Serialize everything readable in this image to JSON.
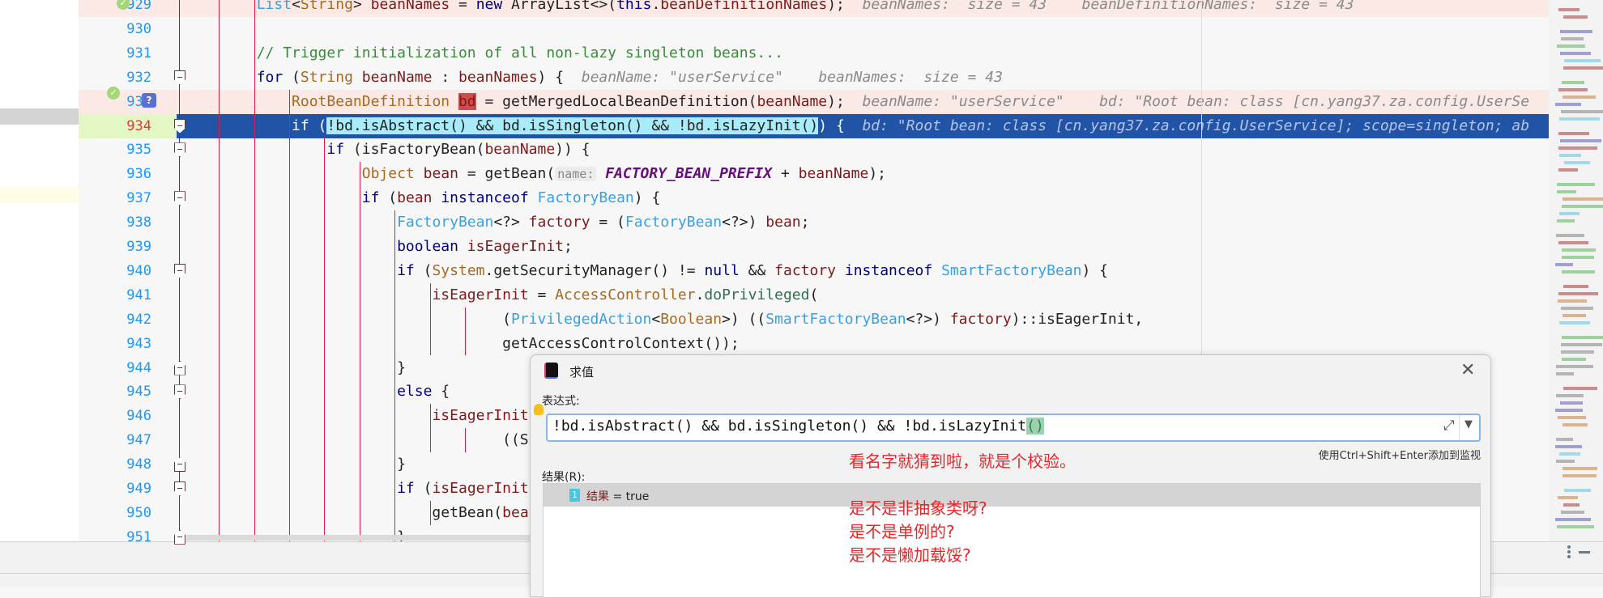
{
  "editor": {
    "lines": [
      {
        "n": "929",
        "bg": "pink",
        "check": true,
        "tokens": [
          [
            "        ",
            ""
          ],
          [
            "List",
            "ty"
          ],
          [
            "<",
            ""
          ],
          [
            "String",
            "cl"
          ],
          [
            "> ",
            ""
          ],
          [
            "beanNames",
            "va"
          ],
          [
            " = ",
            ""
          ],
          [
            "new",
            "kw"
          ],
          [
            " ArrayList<>(",
            ""
          ],
          [
            "this",
            "kw"
          ],
          [
            ".",
            ""
          ],
          [
            "beanDefinitionNames",
            "va"
          ],
          [
            ");",
            ""
          ],
          [
            "  beanNames:  size = 43    beanDefinitionNames:  size = 43",
            "hint"
          ]
        ]
      },
      {
        "n": "930",
        "tokens": []
      },
      {
        "n": "931",
        "tokens": [
          [
            "        ",
            ""
          ],
          [
            "// Trigger initialization of all non-lazy singleton beans...",
            "cm"
          ]
        ]
      },
      {
        "n": "932",
        "tokens": [
          [
            "        ",
            ""
          ],
          [
            "for",
            "kw"
          ],
          [
            " (",
            ""
          ],
          [
            "String",
            "cl"
          ],
          [
            " ",
            ""
          ],
          [
            "beanName",
            "va"
          ],
          [
            " : ",
            ""
          ],
          [
            "beanNames",
            "va"
          ],
          [
            ") {",
            ""
          ],
          [
            "  beanName: \"userService\"    beanNames:  size = 43",
            "hint"
          ]
        ]
      },
      {
        "n": "933",
        "bg": "pink",
        "check": true,
        "question": true,
        "tokens": [
          [
            "            ",
            ""
          ],
          [
            "RootBeanDefinition",
            "cl"
          ],
          [
            " ",
            ""
          ],
          [
            "bd",
            "va bdmark"
          ],
          [
            " = getMergedLocalBeanDefinition(",
            ""
          ],
          [
            "beanName",
            "va"
          ],
          [
            ");",
            ""
          ],
          [
            "  beanName: \"userService\"    bd: \"Root bean: class [cn.yang37.za.config.UserSe",
            "hint"
          ]
        ]
      },
      {
        "n": "934",
        "current": true,
        "tokens": [
          [
            "            if (",
            ""
          ],
          [
            "!bd.isAbstract() && bd.isSingleton() && !bd.isLazyInit()",
            "sel"
          ],
          [
            ") {",
            ""
          ],
          [
            "  bd: \"Root bean: class [cn.yang37.za.config.UserService]; scope=singleton; ab",
            "hint"
          ]
        ]
      },
      {
        "n": "935",
        "tokens": [
          [
            "                ",
            ""
          ],
          [
            "if",
            "kw"
          ],
          [
            " (isFactoryBean(",
            ""
          ],
          [
            "beanName",
            "va"
          ],
          [
            ")) {",
            ""
          ]
        ]
      },
      {
        "n": "936",
        "tokens": [
          [
            "                    ",
            ""
          ],
          [
            "Object",
            "cl"
          ],
          [
            " ",
            ""
          ],
          [
            "bean",
            "va"
          ],
          [
            " = getBean(",
            ""
          ],
          [
            "name:",
            "pname"
          ],
          [
            " ",
            ""
          ],
          [
            "FACTORY_BEAN_PREFIX",
            "co"
          ],
          [
            " + ",
            ""
          ],
          [
            "beanName",
            "va"
          ],
          [
            ");",
            ""
          ]
        ]
      },
      {
        "n": "937",
        "tokens": [
          [
            "                    ",
            ""
          ],
          [
            "if",
            "kw"
          ],
          [
            " (",
            ""
          ],
          [
            "bean",
            "va"
          ],
          [
            " ",
            ""
          ],
          [
            "instanceof",
            "kw"
          ],
          [
            " ",
            ""
          ],
          [
            "FactoryBean",
            "ty"
          ],
          [
            ") {",
            ""
          ]
        ]
      },
      {
        "n": "938",
        "tokens": [
          [
            "                        ",
            ""
          ],
          [
            "FactoryBean",
            "ty"
          ],
          [
            "<?> ",
            ""
          ],
          [
            "factory",
            "va"
          ],
          [
            " = (",
            ""
          ],
          [
            "FactoryBean",
            "ty"
          ],
          [
            "<?>) ",
            ""
          ],
          [
            "bean",
            "va"
          ],
          [
            ";",
            ""
          ]
        ]
      },
      {
        "n": "939",
        "tokens": [
          [
            "                        ",
            ""
          ],
          [
            "boolean",
            "kw"
          ],
          [
            " ",
            ""
          ],
          [
            "isEagerInit",
            "va"
          ],
          [
            ";",
            ""
          ]
        ]
      },
      {
        "n": "940",
        "tokens": [
          [
            "                        ",
            ""
          ],
          [
            "if",
            "kw"
          ],
          [
            " (",
            ""
          ],
          [
            "System",
            "cl"
          ],
          [
            ".getSecurityManager() != ",
            ""
          ],
          [
            "null",
            "kw"
          ],
          [
            " && ",
            ""
          ],
          [
            "factory",
            "va"
          ],
          [
            " ",
            ""
          ],
          [
            "instanceof",
            "kw"
          ],
          [
            " ",
            ""
          ],
          [
            "SmartFactoryBean",
            "ty"
          ],
          [
            ") {",
            ""
          ]
        ]
      },
      {
        "n": "941",
        "tokens": [
          [
            "                            ",
            ""
          ],
          [
            "isEagerInit",
            "va"
          ],
          [
            " = ",
            ""
          ],
          [
            "AccessController",
            "cl"
          ],
          [
            ".",
            ""
          ],
          [
            "doPrivileged",
            "mt"
          ],
          [
            "(",
            ""
          ]
        ]
      },
      {
        "n": "942",
        "tokens": [
          [
            "                                    (",
            ""
          ],
          [
            "PrivilegedAction",
            "ty"
          ],
          [
            "<",
            ""
          ],
          [
            "Boolean",
            "cl"
          ],
          [
            ">) ((",
            ""
          ],
          [
            "SmartFactoryBean",
            "ty"
          ],
          [
            "<?>) ",
            ""
          ],
          [
            "factory",
            "va"
          ],
          [
            ")::isEagerInit,",
            ""
          ]
        ]
      },
      {
        "n": "943",
        "tokens": [
          [
            "                                    getAccessControlContext());",
            ""
          ]
        ]
      },
      {
        "n": "944",
        "tokens": [
          [
            "                        }",
            ""
          ]
        ]
      },
      {
        "n": "945",
        "tokens": [
          [
            "                        ",
            ""
          ],
          [
            "else",
            "kw"
          ],
          [
            " {",
            ""
          ]
        ]
      },
      {
        "n": "946",
        "tokens": [
          [
            "                            ",
            ""
          ],
          [
            "isEagerInit",
            "va"
          ]
        ]
      },
      {
        "n": "947",
        "tokens": [
          [
            "                                    ((S",
            ""
          ]
        ]
      },
      {
        "n": "948",
        "tokens": [
          [
            "                        }",
            ""
          ]
        ]
      },
      {
        "n": "949",
        "tokens": [
          [
            "                        ",
            ""
          ],
          [
            "if",
            "kw"
          ],
          [
            " (",
            ""
          ],
          [
            "isEagerInit",
            "va"
          ]
        ]
      },
      {
        "n": "950",
        "tokens": [
          [
            "                            getBean(",
            ""
          ],
          [
            "bea",
            "va"
          ]
        ]
      },
      {
        "n": "951",
        "tokens": [
          [
            "                        }",
            ""
          ]
        ]
      }
    ]
  },
  "dialog": {
    "title": "求值",
    "expression_label": "表达式:",
    "expression_value": "!bd.isAbstract() && bd.isSingleton() && !bd.isLazyInit",
    "expression_tail": "()",
    "hint": "使用Ctrl+Shift+Enter添加到监视",
    "result_label": "结果(R):",
    "result_icon": "1",
    "result_name": "结果",
    "result_value": " = true"
  },
  "annotations": [
    "看名字就猜到啦，就是个校验。",
    "是不是非抽象类呀?",
    "是不是单例的?",
    "是不是懒加载馁?"
  ],
  "colors": {
    "current_line": "#2154a6",
    "selection": "#a8ecfb",
    "annotation": "#e8262a"
  }
}
